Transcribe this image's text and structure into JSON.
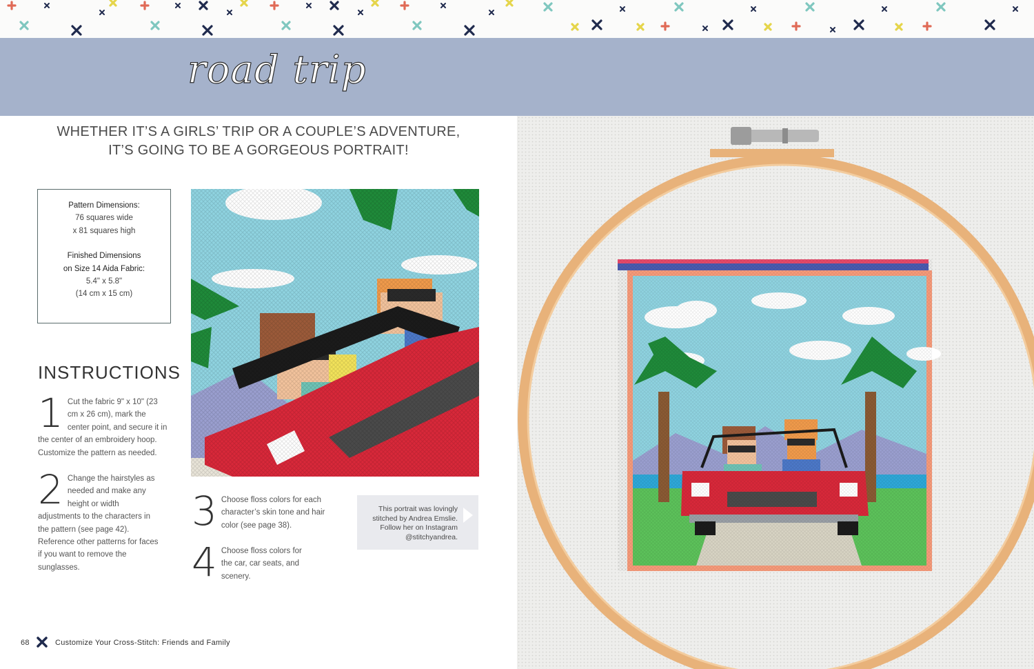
{
  "header": {
    "title": "road trip"
  },
  "tagline": {
    "line1": "WHETHER IT’S A GIRLS’ TRIP OR A COUPLE’S ADVENTURE,",
    "line2": "IT’S GOING TO BE A GORGEOUS PORTRAIT!"
  },
  "dimensions": {
    "pattern_heading": "Pattern Dimensions:",
    "pattern_width": "76 squares wide",
    "pattern_height": "x 81 squares high",
    "finished_heading_1": "Finished Dimensions",
    "finished_heading_2": "on Size 14 Aida Fabric:",
    "finished_in": "5.4\" x 5.8\"",
    "finished_cm": "(14 cm x 15 cm)"
  },
  "instructions": {
    "heading": "INSTRUCTIONS",
    "steps": [
      {
        "num": "1",
        "text": "Cut the fabric 9\" x 10\" (23 cm x 26 cm), mark the center point, and secure it in the center of an embroidery hoop. Customize the pattern as needed."
      },
      {
        "num": "2",
        "text": "Change the hairstyles as needed and make any height or width adjustments to the characters in the pattern (see page 42). Reference other patterns for faces if you want to remove the sunglasses."
      },
      {
        "num": "3",
        "text": "Choose floss colors for each character’s skin tone and hair color (see page 38)."
      },
      {
        "num": "4",
        "text": "Choose floss colors for the car, car seats, and scenery."
      }
    ]
  },
  "credit": {
    "text": "This portrait was lovingly stitched by Andrea Emslie. Follow her on Instagram @stitchyandrea."
  },
  "footer": {
    "page_number": "68",
    "book_title": "Customize Your Cross-Stitch: Friends and Family"
  },
  "colors": {
    "banner": "#a5b2cb",
    "car_red": "#d8283a",
    "sky": "#8fd3e0",
    "palm_green": "#1f8a3a",
    "hoop_wood": "#e8b27a"
  },
  "icons": {
    "footer_mark": "cross-stitch-x-icon",
    "credit_arrow": "play-arrow-icon"
  }
}
